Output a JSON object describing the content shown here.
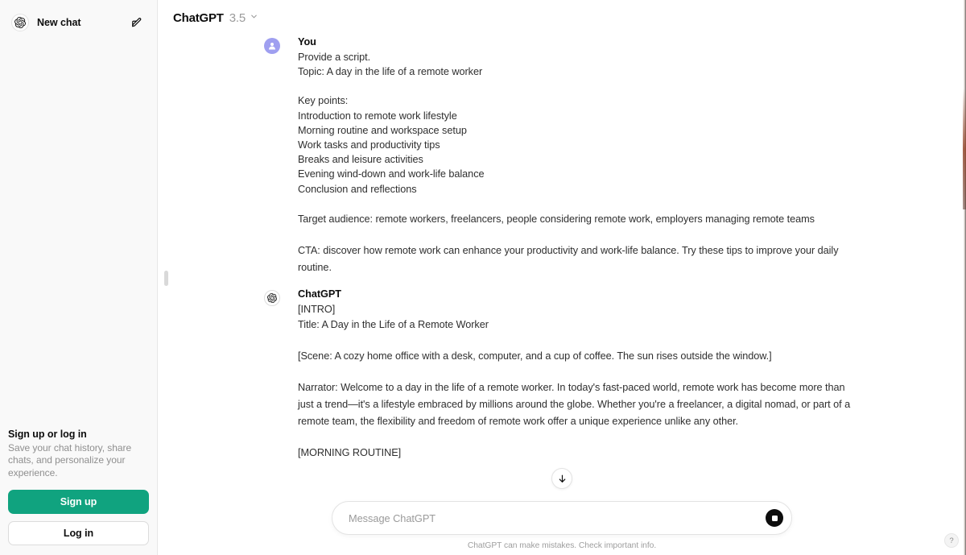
{
  "sidebar": {
    "new_chat_label": "New chat",
    "new_chat_icon": "openai-logo-icon",
    "edit_icon": "new-chat-edit-icon",
    "signup_block": {
      "title": "Sign up or log in",
      "subtitle": "Save your chat history, share chats, and personalize your experience.",
      "signup_label": "Sign up",
      "login_label": "Log in"
    },
    "accent_green": "#10a37f"
  },
  "topbar": {
    "model_name": "ChatGPT",
    "model_version": "3.5",
    "chevron_icon": "chevron-down-icon"
  },
  "conversation": {
    "messages": [
      {
        "author": "You",
        "avatar": "user-avatar-icon",
        "avatar_color": "#9f9ff0",
        "blocks": [
          {
            "type": "lines",
            "lines": [
              "Provide a script.",
              "Topic: A day in the life of a remote worker"
            ]
          },
          {
            "type": "gap"
          },
          {
            "type": "lines",
            "lines": [
              "Key points:",
              "Introduction to remote work lifestyle",
              "Morning routine and workspace setup",
              "Work tasks and productivity tips",
              "Breaks and leisure activities",
              "Evening wind-down and work-life balance",
              "Conclusion and reflections"
            ]
          },
          {
            "type": "gap"
          },
          {
            "type": "para",
            "text": "Target audience: remote workers, freelancers, people considering remote work, employers managing remote teams"
          },
          {
            "type": "para",
            "text": "CTA: discover how remote work can enhance your productivity and work-life balance. Try these tips to improve your daily routine."
          }
        ]
      },
      {
        "author": "ChatGPT",
        "avatar": "openai-logo-icon",
        "blocks": [
          {
            "type": "lines",
            "lines": [
              "[INTRO]"
            ]
          },
          {
            "type": "para",
            "text": "Title: A Day in the Life of a Remote Worker"
          },
          {
            "type": "para",
            "text": "[Scene: A cozy home office with a desk, computer, and a cup of coffee. The sun rises outside the window.]"
          },
          {
            "type": "para",
            "text": "Narrator: Welcome to a day in the life of a remote worker. In today's fast-paced world, remote work has become more than just a trend—it's a lifestyle embraced by millions around the globe. Whether you're a freelancer, a digital nomad, or part of a remote team, the flexibility and freedom of remote work offer a unique experience unlike any other."
          },
          {
            "type": "para",
            "text": "[MORNING ROUTINE]"
          }
        ]
      }
    ],
    "scroll_down_icon": "arrow-down-icon"
  },
  "composer": {
    "placeholder": "Message ChatGPT",
    "value": "",
    "send_icon": "stop-generating-icon",
    "disclaimer": "ChatGPT can make mistakes. Check important info."
  },
  "help": {
    "label": "?"
  }
}
